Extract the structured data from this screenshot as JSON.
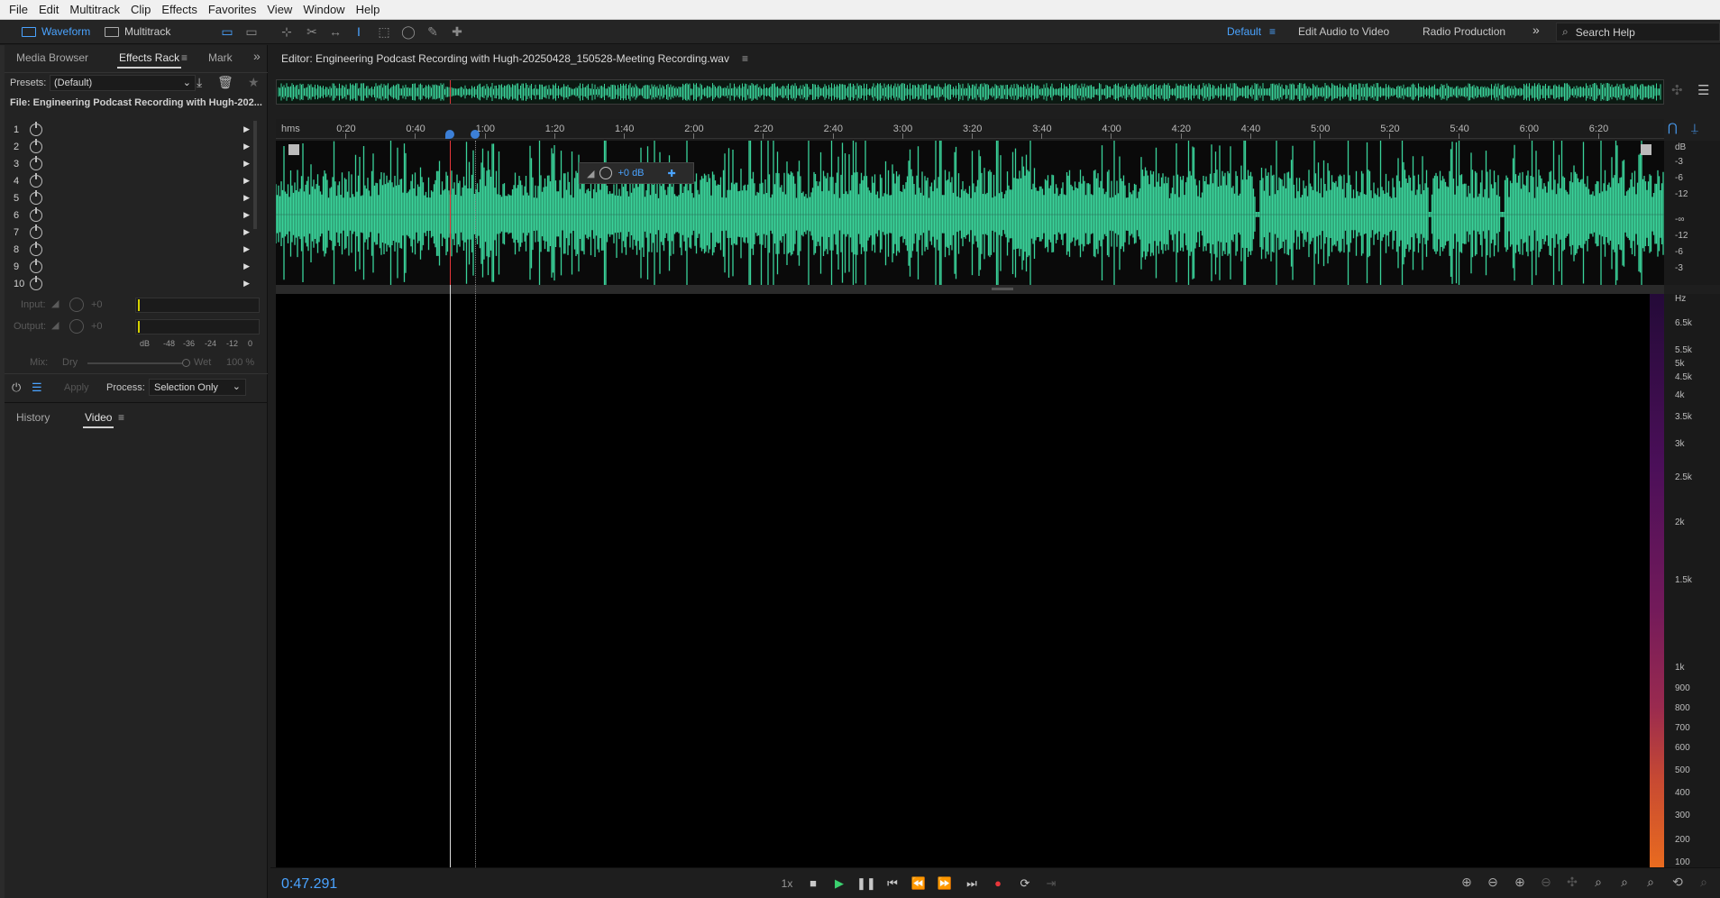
{
  "menu": [
    "File",
    "Edit",
    "Multitrack",
    "Clip",
    "Effects",
    "Favorites",
    "View",
    "Window",
    "Help"
  ],
  "toolbar": {
    "waveform_label": "Waveform",
    "multitrack_label": "Multitrack"
  },
  "workspaces": {
    "default": "Default",
    "edit_audio_video": "Edit Audio to Video",
    "radio": "Radio Production",
    "more": "»"
  },
  "search": {
    "placeholder": "Search Help"
  },
  "panels": {
    "tabs": [
      "Media Browser",
      "Effects Rack",
      "Mark"
    ],
    "more": "»",
    "bottom_tabs": [
      "History",
      "Video"
    ]
  },
  "effects_rack": {
    "presets_label": "Presets:",
    "preset_value": "(Default)",
    "file_label": "File: Engineering Podcast Recording with Hugh-202...",
    "slots": [
      "1",
      "2",
      "3",
      "4",
      "5",
      "6",
      "7",
      "8",
      "9",
      "10"
    ],
    "input_label": "Input:",
    "input_value": "+0",
    "output_label": "Output:",
    "output_value": "+0",
    "scale": [
      "dB",
      "-48",
      "-36",
      "-24",
      "-12",
      "0"
    ],
    "mix_label": "Mix:",
    "dry_label": "Dry",
    "wet_label": "Wet",
    "wet_value": "100 %",
    "apply_label": "Apply",
    "process_label": "Process:",
    "process_value": "Selection Only"
  },
  "editor": {
    "title": "Editor: Engineering Podcast Recording with Hugh-20250428_150528-Meeting Recording.wav",
    "hud_gain": "+0 dB",
    "ruler_unit": "hms",
    "ruler_ticks": [
      "0:20",
      "0:40",
      "1:00",
      "1:20",
      "1:40",
      "2:00",
      "2:20",
      "2:40",
      "3:00",
      "3:20",
      "3:40",
      "4:00",
      "4:20",
      "4:40",
      "5:00",
      "5:20",
      "5:40",
      "6:00",
      "6:20"
    ],
    "db_scale": [
      "dB",
      "-3",
      "-6",
      "-12",
      "-∞",
      "-12",
      "-6",
      "-3"
    ],
    "hz_scale": [
      "Hz",
      "6.5k",
      "5.5k",
      "5k",
      "4.5k",
      "4k",
      "3.5k",
      "3k",
      "2.5k",
      "2k",
      "1.5k",
      "1k",
      "900",
      "800",
      "700",
      "600",
      "500",
      "400",
      "300",
      "200",
      "100"
    ],
    "playhead_fraction": 0.1252,
    "marker_fraction": 0.1438
  },
  "transport": {
    "timecode": "0:47.291",
    "speed": "1x"
  },
  "colors": {
    "accent": "#4aa3ff",
    "waveform": "#3ad39a",
    "playhead": "#e8363a",
    "record": "#e8363a",
    "play": "#3bd16f"
  }
}
